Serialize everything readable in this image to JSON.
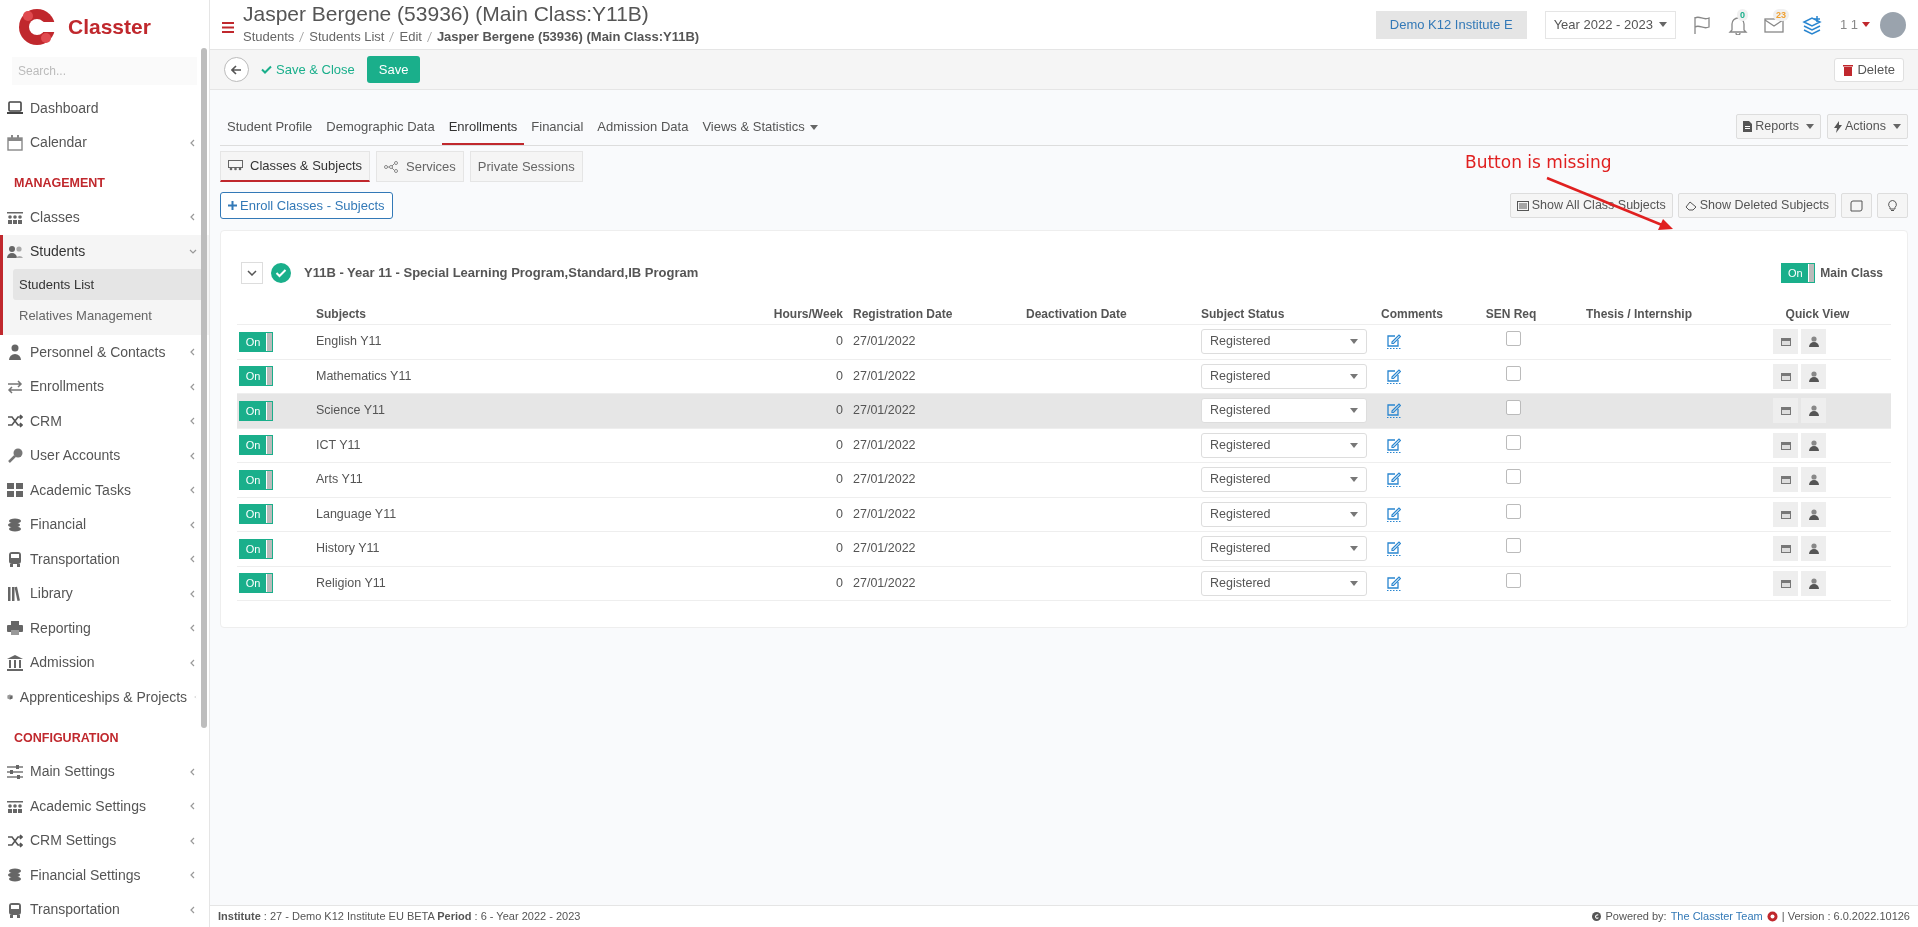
{
  "sidebar": {
    "logo_text": "Classter",
    "search_placeholder": "Search...",
    "entries": [
      {
        "kind": "link",
        "label": "Dashboard",
        "selected": false
      },
      {
        "kind": "group",
        "label": "Calendar",
        "selected": false,
        "expanded": false
      },
      {
        "kind": "heading",
        "label": "MANAGEMENT"
      },
      {
        "kind": "group",
        "label": "Classes",
        "selected": false,
        "expanded": false
      },
      {
        "kind": "group",
        "label": "Students",
        "selected": true,
        "expanded": true,
        "children": [
          {
            "label": "Students List",
            "selected": true
          },
          {
            "label": "Relatives Management",
            "selected": false
          }
        ]
      },
      {
        "kind": "group",
        "label": "Personnel & Contacts",
        "selected": false,
        "expanded": false
      },
      {
        "kind": "group",
        "label": "Enrollments",
        "selected": false,
        "expanded": false
      },
      {
        "kind": "group",
        "label": "CRM",
        "selected": false,
        "expanded": false
      },
      {
        "kind": "group",
        "label": "User Accounts",
        "selected": false,
        "expanded": false
      },
      {
        "kind": "group",
        "label": "Academic Tasks",
        "selected": false,
        "expanded": false
      },
      {
        "kind": "group",
        "label": "Financial",
        "selected": false,
        "expanded": false
      },
      {
        "kind": "group",
        "label": "Transportation",
        "selected": false,
        "expanded": false
      },
      {
        "kind": "group",
        "label": "Library",
        "selected": false,
        "expanded": false
      },
      {
        "kind": "group",
        "label": "Reporting",
        "selected": false,
        "expanded": false
      },
      {
        "kind": "group",
        "label": "Admission",
        "selected": false,
        "expanded": false
      },
      {
        "kind": "group",
        "label": "Apprenticeships & Projects",
        "selected": false,
        "expanded": false
      },
      {
        "kind": "heading",
        "label": "CONFIGURATION"
      },
      {
        "kind": "group",
        "label": "Main Settings",
        "selected": false,
        "expanded": false
      },
      {
        "kind": "group",
        "label": "Academic Settings",
        "selected": false,
        "expanded": false
      },
      {
        "kind": "group",
        "label": "CRM Settings",
        "selected": false,
        "expanded": false
      },
      {
        "kind": "group",
        "label": "Financial Settings",
        "selected": false,
        "expanded": false
      },
      {
        "kind": "group",
        "label": "Transportation",
        "selected": false,
        "expanded": false
      }
    ]
  },
  "header": {
    "title": "Jasper Bergene (53936) (Main Class:Y11B)",
    "breadcrumb": [
      "Students",
      "Students List",
      "Edit",
      "Jasper Bergene (53936) (Main Class:Y11B)"
    ],
    "institute": "Demo K12 Institute E",
    "year": "Year 2022 - 2023",
    "notifications_count": "0",
    "messages_count": "23",
    "user": "1 1"
  },
  "toolbar": {
    "save_close": "Save & Close",
    "save": "Save",
    "delete": "Delete"
  },
  "tabs": [
    {
      "label": "Student Profile",
      "selected": false,
      "kind": "plain"
    },
    {
      "label": "Demographic Data",
      "selected": false,
      "kind": "plain"
    },
    {
      "label": "Enrollments",
      "selected": true,
      "kind": "plain"
    },
    {
      "label": "Financial",
      "selected": false,
      "kind": "plain"
    },
    {
      "label": "Admission Data",
      "selected": false,
      "kind": "plain"
    },
    {
      "label": "Views & Statistics",
      "selected": false,
      "kind": "dropdown"
    }
  ],
  "tab_actions": [
    "Reports",
    "Actions"
  ],
  "subtabs": [
    {
      "label": "Classes & Subjects",
      "selected": true
    },
    {
      "label": "Services",
      "selected": false
    },
    {
      "label": "Private Sessions",
      "selected": false
    }
  ],
  "enroll_button": "Enroll Classes - Subjects",
  "list_actions": [
    "Show All Class Subjects",
    "Show Deleted Subjects"
  ],
  "annotation": "Button is missing",
  "class_card": {
    "expanded": true,
    "title": "Y11B - Year 11 - Special Learning Program,Standard,IB Program",
    "main_class_on": true,
    "main_class_toggle": "On",
    "main_class_label": "Main Class",
    "columns": [
      "Subjects",
      "Hours/Week",
      "Registration Date",
      "Deactivation Date",
      "Subject Status",
      "Comments",
      "SEN Req",
      "Thesis / Internship",
      "Quick View"
    ],
    "rows": [
      {
        "on": true,
        "toggle": "On",
        "subject": "English Y11",
        "hours": "0",
        "registration": "27/01/2022",
        "status": "Registered",
        "sen": false,
        "selected": false
      },
      {
        "on": true,
        "toggle": "On",
        "subject": "Mathematics Y11",
        "hours": "0",
        "registration": "27/01/2022",
        "status": "Registered",
        "sen": false,
        "selected": false
      },
      {
        "on": true,
        "toggle": "On",
        "subject": "Science Y11",
        "hours": "0",
        "registration": "27/01/2022",
        "status": "Registered",
        "sen": false,
        "selected": true
      },
      {
        "on": true,
        "toggle": "On",
        "subject": "ICT Y11",
        "hours": "0",
        "registration": "27/01/2022",
        "status": "Registered",
        "sen": false,
        "selected": false
      },
      {
        "on": true,
        "toggle": "On",
        "subject": "Arts Y11",
        "hours": "0",
        "registration": "27/01/2022",
        "status": "Registered",
        "sen": false,
        "selected": false
      },
      {
        "on": true,
        "toggle": "On",
        "subject": "Language Y11",
        "hours": "0",
        "registration": "27/01/2022",
        "status": "Registered",
        "sen": false,
        "selected": false
      },
      {
        "on": true,
        "toggle": "On",
        "subject": "History Y11",
        "hours": "0",
        "registration": "27/01/2022",
        "status": "Registered",
        "sen": false,
        "selected": false
      },
      {
        "on": true,
        "toggle": "On",
        "subject": "Religion Y11",
        "hours": "0",
        "registration": "27/01/2022",
        "status": "Registered",
        "sen": false,
        "selected": false
      }
    ]
  },
  "footer": {
    "info": "**Institute** : 27 - Demo K12 Institute EU BETA **Period** : 6 - Year 2022 - 2023",
    "powered_by": "Powered by:",
    "team_link": "The Classter Team",
    "version": "| Version : 6.0.2022.10126"
  }
}
